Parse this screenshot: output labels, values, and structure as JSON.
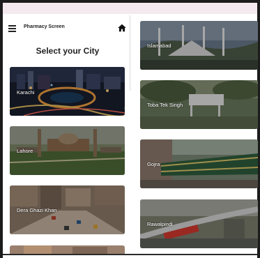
{
  "header": {
    "title": "Pharmacy Screen",
    "menu_icon": "hamburger-menu-icon",
    "home_icon": "home-icon"
  },
  "page": {
    "heading": "Select your City"
  },
  "cities_left": [
    {
      "name": "Karachi"
    },
    {
      "name": "Lahore"
    },
    {
      "name": "Dera Ghazi Khan"
    }
  ],
  "cities_right": [
    {
      "name": "Islamabad"
    },
    {
      "name": "Toba Tek Singh"
    },
    {
      "name": "Gojra"
    },
    {
      "name": "Rawalpindi"
    }
  ],
  "colors": {
    "text": "#222222",
    "card_overlay": "rgba(0,0,0,0.28)"
  }
}
